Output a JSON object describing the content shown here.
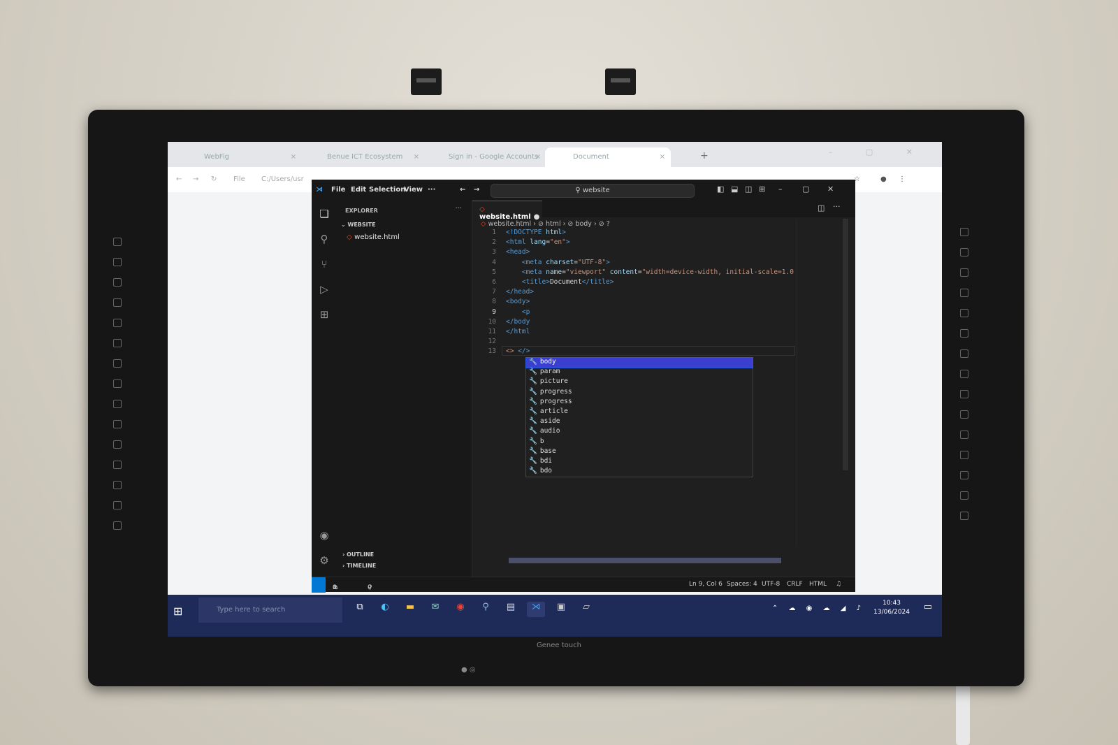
{
  "browser": {
    "tabs": [
      {
        "label": "WebFig"
      },
      {
        "label": "Benue ICT Ecosystem"
      },
      {
        "label": "Sign in - Google Accounts"
      },
      {
        "label": "Document"
      }
    ],
    "new_tab_label": "+",
    "address_prefix": "File",
    "address_value": "C:/Users/usr"
  },
  "vscode": {
    "menu": [
      "File",
      "Edit",
      "Selection",
      "View",
      "···"
    ],
    "command_center": "website",
    "explorer_title": "EXPLORER",
    "explorer_more": "···",
    "folder_name": "WEBSITE",
    "file_name": "website.html",
    "editor_tab": "website.html",
    "breadcrumb": [
      "website.html",
      "html",
      "body",
      "?"
    ],
    "outline_label": "OUTLINE",
    "timeline_label": "TIMELINE",
    "code_lines": [
      {
        "n": "1",
        "html": "<span class='tg'>&lt;!DOCTYPE</span> <span class='at'>html</span><span class='tg'>&gt;</span>"
      },
      {
        "n": "2",
        "html": "<span class='tg'>&lt;html</span> <span class='at'>lang</span>=<span class='st'>\"en\"</span><span class='tg'>&gt;</span>"
      },
      {
        "n": "3",
        "html": "<span class='tg'>&lt;head&gt;</span>"
      },
      {
        "n": "4",
        "html": "    <span class='tg'>&lt;meta</span> <span class='at'>charset</span>=<span class='st'>\"UTF-8\"</span><span class='tg'>&gt;</span>"
      },
      {
        "n": "5",
        "html": "    <span class='tg'>&lt;meta</span> <span class='at'>name</span>=<span class='st'>\"viewport\"</span> <span class='at'>content</span>=<span class='st'>\"width=device-width, initial-scale=1.0</span>"
      },
      {
        "n": "6",
        "html": "    <span class='tg'>&lt;title&gt;</span>Document<span class='tg'>&lt;/title&gt;</span>"
      },
      {
        "n": "7",
        "html": "<span class='tg'>&lt;/head&gt;</span>"
      },
      {
        "n": "8",
        "html": "<span class='tg'>&lt;body&gt;</span>"
      },
      {
        "n": "9",
        "html": "    <span class='tg'>&lt;p</span>"
      },
      {
        "n": "10",
        "html": "<span class='tg'>&lt;/body</span>"
      },
      {
        "n": "11",
        "html": "<span class='tg'>&lt;/html</span>"
      },
      {
        "n": "12",
        "html": ""
      },
      {
        "n": "13",
        "html": "<span class='st'>&lt;&gt;</span> <span class='tg'>&lt;/&gt;</span>"
      }
    ],
    "suggestions": [
      "body",
      "param",
      "picture",
      "progress",
      "progress",
      "article",
      "aside",
      "audio",
      "b",
      "base",
      "bdi",
      "bdo"
    ],
    "status": {
      "errors": "0",
      "warnings": "0",
      "ports": "0",
      "position": "Ln 9, Col 6",
      "spaces": "Spaces: 4",
      "encoding": "UTF-8",
      "eol": "CRLF",
      "language": "HTML"
    }
  },
  "taskbar": {
    "search_placeholder": "Type here to search",
    "time": "10:43",
    "date": "13/06/2024"
  },
  "monitor": {
    "brand": "Genee touch"
  },
  "colors": {
    "accent": "#0078d4",
    "selection": "#3a3fcf",
    "taskbar": "#1e2a57"
  }
}
